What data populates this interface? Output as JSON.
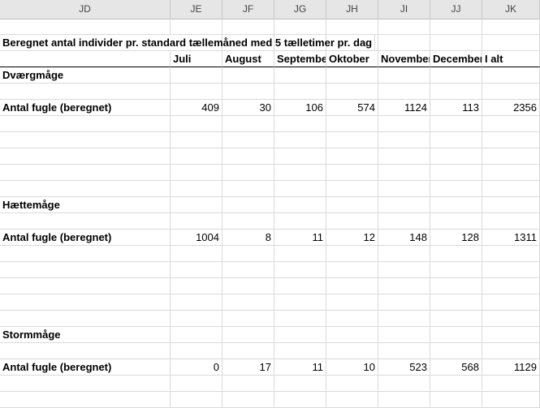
{
  "columns": [
    "JD",
    "JE",
    "JF",
    "JG",
    "JH",
    "JI",
    "JJ",
    "JK"
  ],
  "rows": [
    [
      {
        "t": ""
      },
      {
        "t": ""
      },
      {
        "t": ""
      },
      {
        "t": ""
      },
      {
        "t": ""
      },
      {
        "t": ""
      },
      {
        "t": ""
      },
      {
        "t": ""
      }
    ],
    [
      {
        "t": "Beregnet antal individer pr. standard tællemåned med 5 tælletimer pr. dag",
        "b": true,
        "span": true
      }
    ],
    [
      {
        "t": ""
      },
      {
        "t": "Juli",
        "b": true
      },
      {
        "t": "August",
        "b": true
      },
      {
        "t": "September",
        "b": true
      },
      {
        "t": "Oktober",
        "b": true
      },
      {
        "t": "November",
        "b": true
      },
      {
        "t": "December",
        "b": true
      },
      {
        "t": "I alt",
        "b": true
      }
    ],
    [
      {
        "t": "Dværgmåge",
        "b": true
      },
      {
        "t": ""
      },
      {
        "t": ""
      },
      {
        "t": ""
      },
      {
        "t": ""
      },
      {
        "t": ""
      },
      {
        "t": ""
      },
      {
        "t": ""
      }
    ],
    [
      {
        "t": ""
      },
      {
        "t": ""
      },
      {
        "t": ""
      },
      {
        "t": ""
      },
      {
        "t": ""
      },
      {
        "t": ""
      },
      {
        "t": ""
      },
      {
        "t": ""
      }
    ],
    [
      {
        "t": "Antal fugle (beregnet)",
        "b": true
      },
      {
        "t": "409",
        "n": true
      },
      {
        "t": "30",
        "n": true
      },
      {
        "t": "106",
        "n": true
      },
      {
        "t": "574",
        "n": true
      },
      {
        "t": "1124",
        "n": true
      },
      {
        "t": "113",
        "n": true
      },
      {
        "t": "2356",
        "n": true
      }
    ],
    [
      {
        "t": ""
      },
      {
        "t": ""
      },
      {
        "t": ""
      },
      {
        "t": ""
      },
      {
        "t": ""
      },
      {
        "t": ""
      },
      {
        "t": ""
      },
      {
        "t": ""
      }
    ],
    [
      {
        "t": ""
      },
      {
        "t": ""
      },
      {
        "t": ""
      },
      {
        "t": ""
      },
      {
        "t": ""
      },
      {
        "t": ""
      },
      {
        "t": ""
      },
      {
        "t": ""
      }
    ],
    [
      {
        "t": ""
      },
      {
        "t": ""
      },
      {
        "t": ""
      },
      {
        "t": ""
      },
      {
        "t": ""
      },
      {
        "t": ""
      },
      {
        "t": ""
      },
      {
        "t": ""
      }
    ],
    [
      {
        "t": ""
      },
      {
        "t": ""
      },
      {
        "t": ""
      },
      {
        "t": ""
      },
      {
        "t": ""
      },
      {
        "t": ""
      },
      {
        "t": ""
      },
      {
        "t": ""
      }
    ],
    [
      {
        "t": ""
      },
      {
        "t": ""
      },
      {
        "t": ""
      },
      {
        "t": ""
      },
      {
        "t": ""
      },
      {
        "t": ""
      },
      {
        "t": ""
      },
      {
        "t": ""
      }
    ],
    [
      {
        "t": "Hættemåge",
        "b": true
      },
      {
        "t": ""
      },
      {
        "t": ""
      },
      {
        "t": ""
      },
      {
        "t": ""
      },
      {
        "t": ""
      },
      {
        "t": ""
      },
      {
        "t": ""
      }
    ],
    [
      {
        "t": ""
      },
      {
        "t": ""
      },
      {
        "t": ""
      },
      {
        "t": ""
      },
      {
        "t": ""
      },
      {
        "t": ""
      },
      {
        "t": ""
      },
      {
        "t": ""
      }
    ],
    [
      {
        "t": "Antal fugle (beregnet)",
        "b": true
      },
      {
        "t": "1004",
        "n": true
      },
      {
        "t": "8",
        "n": true
      },
      {
        "t": "11",
        "n": true
      },
      {
        "t": "12",
        "n": true
      },
      {
        "t": "148",
        "n": true
      },
      {
        "t": "128",
        "n": true
      },
      {
        "t": "1311",
        "n": true
      }
    ],
    [
      {
        "t": ""
      },
      {
        "t": ""
      },
      {
        "t": ""
      },
      {
        "t": ""
      },
      {
        "t": ""
      },
      {
        "t": ""
      },
      {
        "t": ""
      },
      {
        "t": ""
      }
    ],
    [
      {
        "t": ""
      },
      {
        "t": ""
      },
      {
        "t": ""
      },
      {
        "t": ""
      },
      {
        "t": ""
      },
      {
        "t": ""
      },
      {
        "t": ""
      },
      {
        "t": ""
      }
    ],
    [
      {
        "t": ""
      },
      {
        "t": ""
      },
      {
        "t": ""
      },
      {
        "t": ""
      },
      {
        "t": ""
      },
      {
        "t": ""
      },
      {
        "t": ""
      },
      {
        "t": ""
      }
    ],
    [
      {
        "t": ""
      },
      {
        "t": ""
      },
      {
        "t": ""
      },
      {
        "t": ""
      },
      {
        "t": ""
      },
      {
        "t": ""
      },
      {
        "t": ""
      },
      {
        "t": ""
      }
    ],
    [
      {
        "t": ""
      },
      {
        "t": ""
      },
      {
        "t": ""
      },
      {
        "t": ""
      },
      {
        "t": ""
      },
      {
        "t": ""
      },
      {
        "t": ""
      },
      {
        "t": ""
      }
    ],
    [
      {
        "t": "Stormmåge",
        "b": true
      },
      {
        "t": ""
      },
      {
        "t": ""
      },
      {
        "t": ""
      },
      {
        "t": ""
      },
      {
        "t": ""
      },
      {
        "t": ""
      },
      {
        "t": ""
      }
    ],
    [
      {
        "t": ""
      },
      {
        "t": ""
      },
      {
        "t": ""
      },
      {
        "t": ""
      },
      {
        "t": ""
      },
      {
        "t": ""
      },
      {
        "t": ""
      },
      {
        "t": ""
      }
    ],
    [
      {
        "t": "Antal fugle (beregnet)",
        "b": true
      },
      {
        "t": "0",
        "n": true
      },
      {
        "t": "17",
        "n": true
      },
      {
        "t": "11",
        "n": true
      },
      {
        "t": "10",
        "n": true
      },
      {
        "t": "523",
        "n": true
      },
      {
        "t": "568",
        "n": true
      },
      {
        "t": "1129",
        "n": true
      }
    ],
    [
      {
        "t": ""
      },
      {
        "t": ""
      },
      {
        "t": ""
      },
      {
        "t": ""
      },
      {
        "t": ""
      },
      {
        "t": ""
      },
      {
        "t": ""
      },
      {
        "t": ""
      }
    ],
    [
      {
        "t": ""
      },
      {
        "t": ""
      },
      {
        "t": ""
      },
      {
        "t": ""
      },
      {
        "t": ""
      },
      {
        "t": ""
      },
      {
        "t": ""
      },
      {
        "t": ""
      }
    ]
  ]
}
